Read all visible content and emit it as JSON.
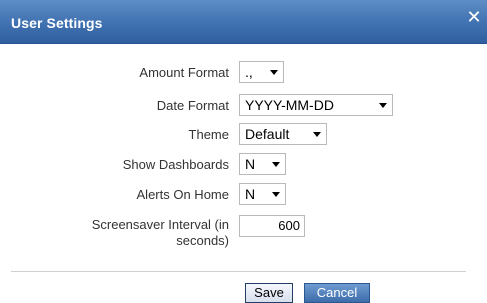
{
  "dialog": {
    "title": "User Settings",
    "close_glyph": "✕"
  },
  "fields": {
    "amount_format": {
      "label": "Amount Format",
      "value": ".,"
    },
    "date_format": {
      "label": "Date Format",
      "value": "YYYY-MM-DD"
    },
    "theme": {
      "label": "Theme",
      "value": "Default"
    },
    "show_dashboards": {
      "label": "Show Dashboards",
      "value": "N"
    },
    "alerts_on_home": {
      "label": "Alerts On Home",
      "value": "N"
    },
    "screensaver_interval": {
      "label_line1": "Screensaver Interval (in",
      "label_line2": "seconds)",
      "value": "600"
    }
  },
  "buttons": {
    "save_label": "Save",
    "cancel_label": "Cancel"
  },
  "colors": {
    "titlebar": "#4273b2",
    "cancel_button": "#3d6cab"
  }
}
